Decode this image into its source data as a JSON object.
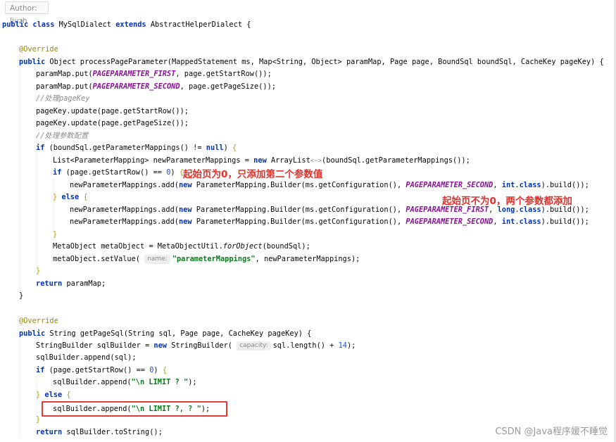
{
  "header": {
    "author": "Author: liuzh"
  },
  "code": {
    "l1": [
      "public class",
      "MySqlDialect",
      "extends",
      "AbstractHelperDialect {"
    ],
    "l2": [
      "@Override"
    ],
    "l3": [
      "public",
      "Object processPageParameter(MappedStatement ms, Map<String, Object> paramMap, Page page, BoundSql boundSql, CacheKey pageKey) {"
    ],
    "l4": [
      "paramMap.put(",
      "PAGEPARAMETER_FIRST",
      ", page.getStartRow());"
    ],
    "l5": [
      "paramMap.put(",
      "PAGEPARAMETER_SECOND",
      ", page.getPageSize());"
    ],
    "l6": [
      "//处理pageKey"
    ],
    "l7": [
      "pageKey.update(page.getStartRow());"
    ],
    "l8": [
      "pageKey.update(page.getPageSize());"
    ],
    "l9": [
      "//处理参数配置"
    ],
    "l10": [
      "if",
      "(boundSql.getParameterMappings() !=",
      "null",
      ")",
      "{"
    ],
    "l11": [
      "List<ParameterMapping> newParameterMappings =",
      "new",
      "ArrayList",
      "<~>",
      "(boundSql.getParameterMappings());"
    ],
    "l12": [
      "if",
      "(page.getStartRow() ==",
      "0",
      ")",
      "{"
    ],
    "l13": [
      "newParameterMappings.add(",
      "new",
      "ParameterMapping.Builder(ms.getConfiguration(),",
      "PAGEPARAMETER_SECOND",
      ",",
      "int",
      ".",
      "class",
      ").build());"
    ],
    "l14": [
      "}",
      "else",
      "{"
    ],
    "l15": [
      "newParameterMappings.add(",
      "new",
      "ParameterMapping.Builder(ms.getConfiguration(),",
      "PAGEPARAMETER_FIRST",
      ",",
      "long",
      ".",
      "class",
      ").build());"
    ],
    "l16": [
      "newParameterMappings.add(",
      "new",
      "ParameterMapping.Builder(ms.getConfiguration(),",
      "PAGEPARAMETER_SECOND",
      ",",
      "int",
      ".",
      "class",
      ").build());"
    ],
    "l17": [
      "}"
    ],
    "l18": [
      "MetaObject metaObject = MetaObjectUtil.",
      "forObject",
      "(boundSql);"
    ],
    "l19": [
      "metaObject.setValue(",
      "name:",
      "\"parameterMappings\"",
      ", newParameterMappings);"
    ],
    "l20": [
      "}"
    ],
    "l21": [
      "return",
      "paramMap;"
    ],
    "l22": [
      "}"
    ],
    "l23": [
      "@Override"
    ],
    "l24": [
      "public",
      "String getPageSql(String sql, Page page, CacheKey pageKey) {"
    ],
    "l25": [
      "StringBuilder sqlBuilder =",
      "new",
      "StringBuilder(",
      "capacity:",
      "sql.length() +",
      "14",
      ");"
    ],
    "l26": [
      "sqlBuilder.append(sql);"
    ],
    "l27": [
      "if",
      "(page.getStartRow() ==",
      "0",
      ")",
      "{"
    ],
    "l28": [
      "sqlBuilder.append(",
      "\"\\n LIMIT ? \"",
      ");"
    ],
    "l29": [
      "}",
      "else",
      "{"
    ],
    "l30": [
      "sqlBuilder.append(",
      "\"\\n LIMIT ?, ? \"",
      ");"
    ],
    "l31": [
      "}"
    ],
    "l32": [
      "return",
      "sqlBuilder.toString();"
    ]
  },
  "annotations": {
    "first": "起始页为0，只添加第二个参数值",
    "second": "起始页不为0，两个参数都添加"
  },
  "watermark": "CSDN @Java程序媛不睡觉",
  "colors": {
    "keyword": "#0033b3",
    "annotation": "#9e880d",
    "constant": "#871094",
    "comment": "#8c8c8c",
    "string": "#067d17",
    "number": "#1750eb",
    "note_red": "#e0302a"
  }
}
